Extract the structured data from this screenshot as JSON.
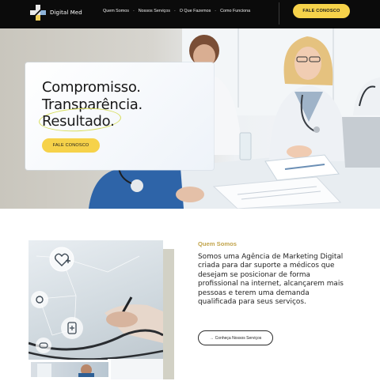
{
  "header": {
    "brand": "Digital Med",
    "nav": [
      {
        "label": "Quem Somos"
      },
      {
        "label": "Nossos Serviços"
      },
      {
        "label": "O Que Fazemos"
      },
      {
        "label": "Como Funciona"
      }
    ],
    "nav_separator": "-",
    "cta_label": "FALE CONOSCO"
  },
  "hero": {
    "line1": "Compromisso.",
    "line2": "Transparência.",
    "line3": "Resultado.",
    "cta_label": "FALE CONOSCO"
  },
  "about": {
    "eyebrow": "Quem Somos",
    "text": "Somos uma Agência de Marketing Digital criada para dar suporte a médicos que desejam se posicionar de forma profissional na internet, alcançarem mais pessoas e terem uma demanda qualificada para seus serviços.",
    "button_arrow": "→",
    "button_label": "Conheça Nossos Serviços"
  },
  "colors": {
    "accent_yellow": "#f6d24a",
    "eyebrow_gold": "#c2a44b",
    "highlight_lime": "#d7dd59",
    "nav_bg": "#0b0b0b"
  },
  "icons": [
    "logo-cross-icon",
    "heart-plus-icon",
    "stethoscope-icon",
    "medical-record-icon",
    "pill-icon",
    "arrow-right-icon"
  ]
}
